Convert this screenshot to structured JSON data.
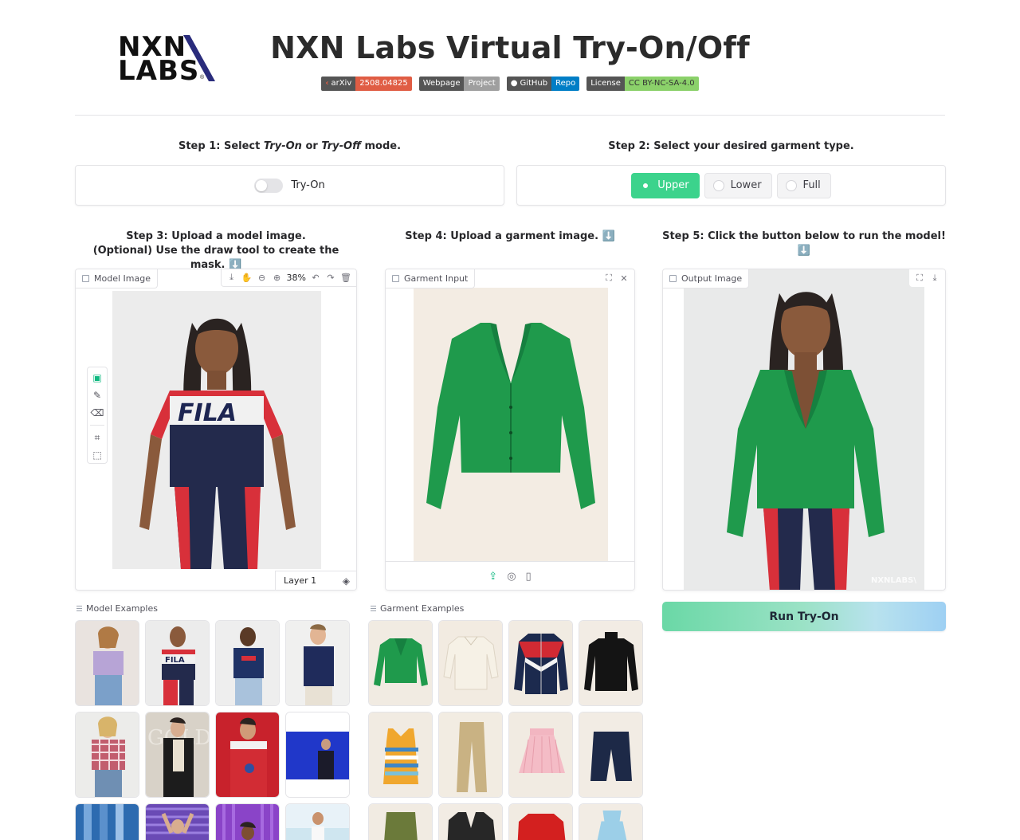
{
  "header": {
    "logo_line1": "NXN",
    "logo_line2": "LABS",
    "logo_reg": "®",
    "title": "NXN Labs Virtual Try-On/Off"
  },
  "badges": [
    {
      "left": "arXiv",
      "right": "2508.04825",
      "icon": "arxiv-icon"
    },
    {
      "left": "Webpage",
      "right": "Project"
    },
    {
      "left": "GitHub",
      "right": "Repo",
      "icon": "github-icon"
    },
    {
      "left": "License",
      "right": "CC BY-NC-SA-4.0"
    }
  ],
  "step1": {
    "prefix": "Step 1: Select ",
    "opt1": "Try-On",
    "mid": " or ",
    "opt2": "Try-Off",
    "suffix": " mode.",
    "toggle_label": "Try-On",
    "toggle_on": false
  },
  "step2": {
    "title": "Step 2: Select your desired garment type.",
    "options": [
      "Upper",
      "Lower",
      "Full"
    ],
    "selected": "Upper"
  },
  "step3": {
    "title_line1": "Step 3: Upload a model image.",
    "title_line2": "(Optional) Use the draw tool to create the mask. ⬇️",
    "label": "Model Image",
    "zoom": "38%",
    "layer": "Layer 1"
  },
  "step4": {
    "title": "Step 4: Upload a garment image. ⬇️",
    "label": "Garment Input"
  },
  "step5": {
    "title": "Step 5: Click the button below to run the model! ⬇️",
    "label": "Output Image",
    "watermark": "NXNLABS\\",
    "run_label": "Run Try-On"
  },
  "examples": {
    "model_label": "Model Examples",
    "garment_label": "Garment Examples"
  },
  "colors": {
    "accent_green": "#3cd38c",
    "garment_green": "#1f9a4c",
    "arxiv_red": "#e05d44",
    "github_blue": "#007ec6",
    "license_green": "#8bd16a"
  }
}
